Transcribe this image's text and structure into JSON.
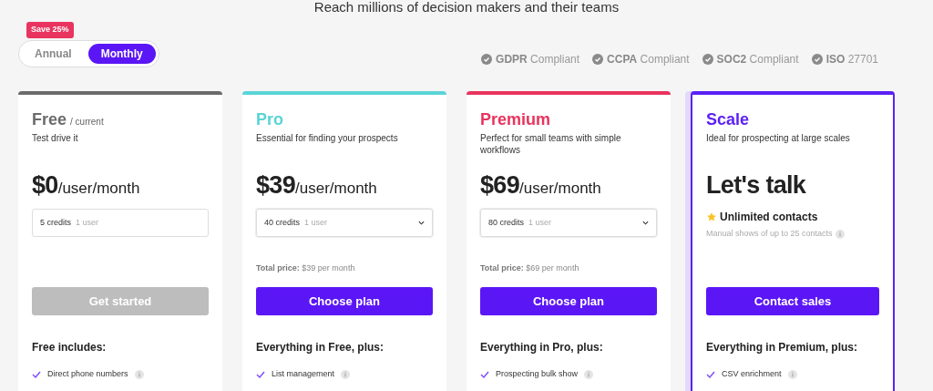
{
  "headline": "Reach millions of decision makers and their teams",
  "billing_toggle": {
    "badge": "Save 25%",
    "options": [
      {
        "label": "Annual",
        "selected": false
      },
      {
        "label": "Monthly",
        "selected": true
      }
    ]
  },
  "compliance": [
    "**GDPR** Compliant",
    "**CCPA** Compliant",
    "**SOC2** Compliant",
    "**ISO** 27701"
  ],
  "plans": [
    {
      "name": "Free",
      "color": "#6b6b6b",
      "tag": "/ current",
      "description": "Test drive it",
      "price": "$0",
      "price_unit": "/user/month",
      "selector": {
        "credits": "5 credits",
        "users": "1 user",
        "dropdown": false
      },
      "button": {
        "label": "Get started",
        "disabled": true
      },
      "includes_title": "Free includes:",
      "features": [
        "Direct phone numbers"
      ],
      "highlighted": false
    },
    {
      "name": "Pro",
      "color": "#5ad4d6",
      "description": "Essential for finding your prospects",
      "price": "$39",
      "price_unit": "/user/month",
      "selector": {
        "credits": "40 credits",
        "users": "1 user",
        "dropdown": true
      },
      "total": {
        "label": "Total price:",
        "value": "$39 per month"
      },
      "button": {
        "label": "Choose plan",
        "disabled": false
      },
      "includes_title": "Everything in Free, plus:",
      "features": [
        "List management"
      ],
      "highlighted": false
    },
    {
      "name": "Premium",
      "color": "#e8345e",
      "description": "Perfect for small teams with simple workflows",
      "price": "$69",
      "price_unit": "/user/month",
      "selector": {
        "credits": "80 credits",
        "users": "1 user",
        "dropdown": true
      },
      "total": {
        "label": "Total price:",
        "value": "$69 per month"
      },
      "button": {
        "label": "Choose plan",
        "disabled": false
      },
      "includes_title": "Everything in Pro, plus:",
      "features": [
        "Prospecting bulk show"
      ],
      "highlighted": false
    },
    {
      "name": "Scale",
      "color": "#5b21f5",
      "description": "Ideal for prospecting at large scales",
      "price": "Let's talk",
      "perk": {
        "title": "Unlimited contacts",
        "note": "Manual shows of up to 25 contacts"
      },
      "button": {
        "label": "Contact sales",
        "disabled": false
      },
      "includes_title": "Everything in Premium, plus:",
      "features": [
        "CSV enrichment"
      ],
      "highlighted": true
    }
  ]
}
